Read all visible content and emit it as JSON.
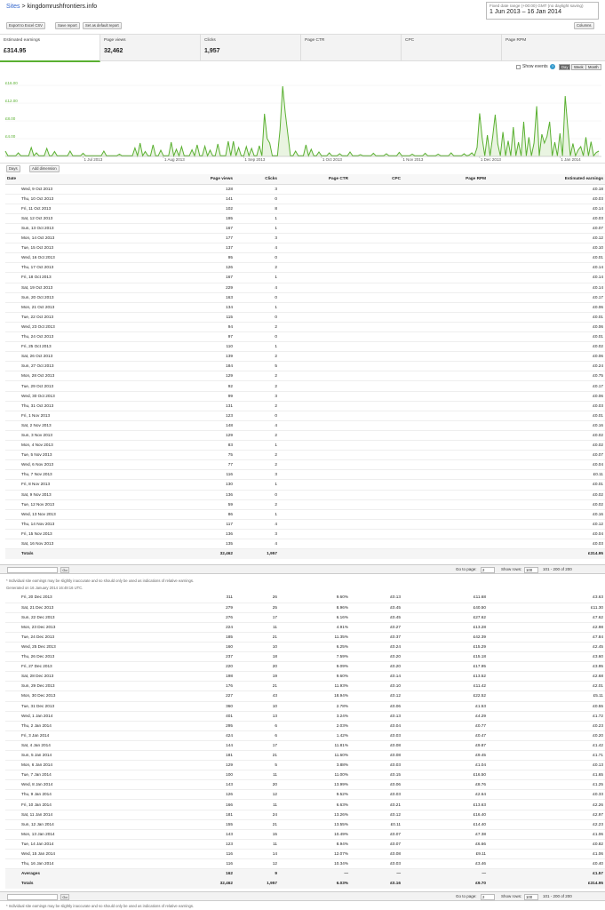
{
  "header": {
    "crumb_root": "Sites",
    "crumb_sep": ">",
    "site": "kingdomrushfrontiers.info",
    "date_hint": "Fixed date range (+00:00) GMT (no daylight saving)",
    "date_range": "1 Jun 2013 – 16 Jan 2014"
  },
  "toolbar": {
    "export": "Export to Excel CSV",
    "save": "Save report",
    "default": "Set as default report",
    "columns": "Columns"
  },
  "tabs": [
    {
      "label": "Estimated earnings",
      "value": "£314.95"
    },
    {
      "label": "Page views",
      "value": "32,462"
    },
    {
      "label": "Clicks",
      "value": "1,957"
    },
    {
      "label": "Page CTR",
      "value": ""
    },
    {
      "label": "CPC",
      "value": ""
    },
    {
      "label": "Page RPM",
      "value": ""
    }
  ],
  "chart_opts": {
    "show_events": "Show events",
    "help": "?",
    "day": "Day",
    "week": "Week",
    "month": "Month"
  },
  "chart_data": {
    "type": "area",
    "series_color": "#5ab031",
    "y_ticks": [
      "£16.00",
      "£12.00",
      "£8.00",
      "£4.00"
    ],
    "ylim": [
      0,
      18
    ],
    "x_ticks": [
      "1 Jul 2013",
      "1 Aug 2013",
      "1 Sep 2013",
      "1 Oct 2013",
      "1 Nov 2013",
      "1 Dec 2013",
      "1 Jan 2014"
    ],
    "x_tick_days": [
      30,
      61,
      92,
      122,
      153,
      183,
      214
    ],
    "n_days": 230,
    "peaks": [
      [
        0,
        1.2
      ],
      [
        5,
        0.8
      ],
      [
        10,
        2.0
      ],
      [
        12,
        0.8
      ],
      [
        16,
        1.8
      ],
      [
        19,
        1.1
      ],
      [
        25,
        1.2
      ],
      [
        30,
        0.7
      ],
      [
        38,
        1.2
      ],
      [
        44,
        0.5
      ],
      [
        50,
        1.9
      ],
      [
        52,
        3.0
      ],
      [
        54,
        1.1
      ],
      [
        57,
        2.6
      ],
      [
        60,
        1.4
      ],
      [
        64,
        3.2
      ],
      [
        66,
        1.6
      ],
      [
        68,
        2.2
      ],
      [
        72,
        1.5
      ],
      [
        74,
        2.6
      ],
      [
        77,
        2.3
      ],
      [
        79,
        1.4
      ],
      [
        82,
        2.8
      ],
      [
        86,
        3.4
      ],
      [
        88,
        3.4
      ],
      [
        90,
        2.0
      ],
      [
        93,
        2.2
      ],
      [
        95,
        1.8
      ],
      [
        98,
        2.4
      ],
      [
        100,
        9.6
      ],
      [
        101,
        4.0
      ],
      [
        102,
        3.0
      ],
      [
        106,
        6.0
      ],
      [
        107,
        15.8
      ],
      [
        108,
        9.8
      ],
      [
        109,
        5.0
      ],
      [
        112,
        1.2
      ],
      [
        116,
        2.6
      ],
      [
        118,
        1.6
      ],
      [
        121,
        1.0
      ],
      [
        125,
        0.8
      ],
      [
        129,
        0.6
      ],
      [
        133,
        1.0
      ],
      [
        137,
        0.4
      ],
      [
        142,
        0.7
      ],
      [
        147,
        0.6
      ],
      [
        152,
        0.9
      ],
      [
        157,
        0.5
      ],
      [
        162,
        0.7
      ],
      [
        167,
        0.5
      ],
      [
        172,
        0.8
      ],
      [
        177,
        0.6
      ],
      [
        179,
        0.3
      ],
      [
        180,
        0.8
      ],
      [
        182,
        2.0
      ],
      [
        183,
        9.7
      ],
      [
        184,
        4.0
      ],
      [
        186,
        4.8
      ],
      [
        188,
        4.3
      ],
      [
        189,
        9.4
      ],
      [
        190,
        2.8
      ],
      [
        192,
        5.5
      ],
      [
        194,
        3.5
      ],
      [
        196,
        6.6
      ],
      [
        198,
        3.2
      ],
      [
        200,
        7.8
      ],
      [
        202,
        4.3
      ],
      [
        204,
        3.0
      ],
      [
        205,
        11.3
      ],
      [
        207,
        5.0
      ],
      [
        208,
        3.0
      ],
      [
        209,
        4.5
      ],
      [
        210,
        7.8
      ],
      [
        212,
        3.2
      ],
      [
        214,
        5.2
      ],
      [
        216,
        13.6
      ],
      [
        217,
        6.5
      ],
      [
        219,
        2.9
      ],
      [
        221,
        1.4
      ],
      [
        222,
        2.2
      ],
      [
        224,
        4.3
      ],
      [
        226,
        3.3
      ],
      [
        228,
        0.9
      ],
      [
        229,
        1.2
      ]
    ]
  },
  "dims": {
    "primary": "Days",
    "add": "Add dimension"
  },
  "table_headers": [
    "Date",
    "Page views",
    "Clicks",
    "Page CTR",
    "CPC",
    "Page RPM",
    "Estimated earnings"
  ],
  "rows1": [
    [
      "Wed, 9 Oct 2013",
      "128",
      "3",
      "",
      "",
      "",
      "£0.18"
    ],
    [
      "Thu, 10 Oct 2013",
      "141",
      "0",
      "",
      "",
      "",
      "£0.03"
    ],
    [
      "Fri, 11 Oct 2013",
      "102",
      "8",
      "",
      "",
      "",
      "£0.14"
    ],
    [
      "Sat, 12 Oct 2013",
      "195",
      "1",
      "",
      "",
      "",
      "£0.03"
    ],
    [
      "Sun, 13 Oct 2013",
      "167",
      "1",
      "",
      "",
      "",
      "£0.07"
    ],
    [
      "Mon, 14 Oct 2013",
      "177",
      "3",
      "",
      "",
      "",
      "£0.12"
    ],
    [
      "Tue, 15 Oct 2013",
      "137",
      "4",
      "",
      "",
      "",
      "£0.10"
    ],
    [
      "Wed, 16 Oct 2013",
      "95",
      "0",
      "",
      "",
      "",
      "£0.01"
    ],
    [
      "Thu, 17 Oct 2013",
      "126",
      "2",
      "",
      "",
      "",
      "£0.14"
    ],
    [
      "Fri, 18 Oct 2013",
      "167",
      "1",
      "",
      "",
      "",
      "£0.14"
    ],
    [
      "Sat, 19 Oct 2013",
      "229",
      "4",
      "",
      "",
      "",
      "£0.14"
    ],
    [
      "Sun, 20 Oct 2013",
      "163",
      "0",
      "",
      "",
      "",
      "£0.17"
    ],
    [
      "Mon, 21 Oct 2013",
      "134",
      "1",
      "",
      "",
      "",
      "£0.06"
    ],
    [
      "Tue, 22 Oct 2013",
      "115",
      "0",
      "",
      "",
      "",
      "£0.01"
    ],
    [
      "Wed, 23 Oct 2013",
      "94",
      "2",
      "",
      "",
      "",
      "£0.06"
    ],
    [
      "Thu, 24 Oct 2013",
      "97",
      "0",
      "",
      "",
      "",
      "£0.01"
    ],
    [
      "Fri, 25 Oct 2013",
      "110",
      "1",
      "",
      "",
      "",
      "£0.02"
    ],
    [
      "Sat, 26 Oct 2013",
      "139",
      "2",
      "",
      "",
      "",
      "£0.06"
    ],
    [
      "Sun, 27 Oct 2013",
      "184",
      "5",
      "",
      "",
      "",
      "£0.24"
    ],
    [
      "Mon, 28 Oct 2013",
      "129",
      "2",
      "",
      "",
      "",
      "£0.75"
    ],
    [
      "Tue, 29 Oct 2013",
      "92",
      "2",
      "",
      "",
      "",
      "£0.17"
    ],
    [
      "Wed, 30 Oct 2013",
      "99",
      "3",
      "",
      "",
      "",
      "£0.06"
    ],
    [
      "Thu, 31 Oct 2013",
      "131",
      "2",
      "",
      "",
      "",
      "£0.03"
    ],
    [
      "Fri, 1 Nov 2013",
      "123",
      "0",
      "",
      "",
      "",
      "£0.01"
    ],
    [
      "Sat, 2 Nov 2013",
      "148",
      "4",
      "",
      "",
      "",
      "£0.16"
    ],
    [
      "Sun, 3 Nov 2013",
      "129",
      "2",
      "",
      "",
      "",
      "£0.02"
    ],
    [
      "Mon, 4 Nov 2013",
      "83",
      "1",
      "",
      "",
      "",
      "£0.02"
    ],
    [
      "Tue, 5 Nov 2013",
      "75",
      "2",
      "",
      "",
      "",
      "£0.07"
    ],
    [
      "Wed, 6 Nov 2013",
      "77",
      "2",
      "",
      "",
      "",
      "£0.04"
    ],
    [
      "Thu, 7 Nov 2013",
      "116",
      "3",
      "",
      "",
      "",
      "£0.11"
    ],
    [
      "Fri, 8 Nov 2013",
      "130",
      "1",
      "",
      "",
      "",
      "£0.01"
    ],
    [
      "Sat, 9 Nov 2013",
      "136",
      "0",
      "",
      "",
      "",
      "£0.02"
    ],
    [
      "Tue, 12 Nov 2013",
      "59",
      "2",
      "",
      "",
      "",
      "£0.02"
    ],
    [
      "Wed, 13 Nov 2013",
      "86",
      "1",
      "",
      "",
      "",
      "£0.16"
    ],
    [
      "Thu, 14 Nov 2013",
      "117",
      "4",
      "",
      "",
      "",
      "£0.12"
    ],
    [
      "Fri, 15 Nov 2013",
      "136",
      "3",
      "",
      "",
      "",
      "£0.04"
    ],
    [
      "Sat, 16 Nov 2013",
      "135",
      "4",
      "",
      "",
      "",
      "£0.03"
    ]
  ],
  "totals1": [
    "Totals",
    "32,462",
    "1,957",
    "",
    "",
    "",
    "£314.95"
  ],
  "pager": {
    "goto": "Go to page:",
    "page": "2",
    "show_rows": "Show rows:",
    "rows": "100",
    "range": "101 - 200 of 200",
    "go": "Go"
  },
  "note1": "* Individual site earnings may be slightly inaccurate and so should only be used as indications of relative earnings.",
  "generated": "Generated on 16 January 2014 16:49:16 UTC.",
  "rows2": [
    [
      "Fri, 20 Dec 2013",
      "311",
      "26",
      "9.60%",
      "£0.13",
      "£11.68",
      "£3.63"
    ],
    [
      "Sat, 21 Dec 2013",
      "279",
      "25",
      "8.96%",
      "£0.45",
      "£40.50",
      "£11.30"
    ],
    [
      "Sun, 22 Dec 2013",
      "276",
      "17",
      "6.16%",
      "£0.45",
      "£27.62",
      "£7.62"
    ],
    [
      "Mon, 23 Dec 2013",
      "224",
      "11",
      "4.91%",
      "£0.27",
      "£13.28",
      "£2.98"
    ],
    [
      "Tue, 24 Dec 2013",
      "185",
      "21",
      "11.35%",
      "£0.37",
      "£42.39",
      "£7.84"
    ],
    [
      "Wed, 25 Dec 2013",
      "160",
      "10",
      "6.25%",
      "£0.24",
      "£15.29",
      "£2.45"
    ],
    [
      "Thu, 26 Dec 2013",
      "237",
      "18",
      "7.59%",
      "£0.20",
      "£15.18",
      "£3.60"
    ],
    [
      "Fri, 27 Dec 2013",
      "220",
      "20",
      "9.09%",
      "£0.20",
      "£17.95",
      "£3.95"
    ],
    [
      "Sat, 28 Dec 2013",
      "198",
      "19",
      "9.60%",
      "£0.14",
      "£13.52",
      "£2.68"
    ],
    [
      "Sun, 29 Dec 2013",
      "176",
      "21",
      "11.93%",
      "£0.10",
      "£11.42",
      "£2.01"
    ],
    [
      "Mon, 30 Dec 2013",
      "227",
      "43",
      "18.94%",
      "£0.12",
      "£22.52",
      "£5.11"
    ],
    [
      "Tue, 31 Dec 2013",
      "360",
      "10",
      "2.78%",
      "£0.06",
      "£1.53",
      "£0.55"
    ],
    [
      "Wed, 1 Jan 2014",
      "401",
      "13",
      "3.24%",
      "£0.13",
      "£4.29",
      "£1.72"
    ],
    [
      "Thu, 2 Jan 2014",
      "295",
      "6",
      "2.03%",
      "£0.04",
      "£0.77",
      "£0.23"
    ],
    [
      "Fri, 3 Jan 2014",
      "424",
      "6",
      "1.42%",
      "£0.03",
      "£0.47",
      "£0.20"
    ],
    [
      "Sat, 4 Jan 2014",
      "144",
      "17",
      "11.81%",
      "£0.08",
      "£9.87",
      "£1.42"
    ],
    [
      "Sun, 5 Jan 2014",
      "181",
      "21",
      "11.60%",
      "£0.08",
      "£9.45",
      "£1.71"
    ],
    [
      "Mon, 6 Jan 2014",
      "129",
      "5",
      "3.88%",
      "£0.03",
      "£1.04",
      "£0.13"
    ],
    [
      "Tue, 7 Jan 2014",
      "100",
      "11",
      "11.00%",
      "£0.15",
      "£16.50",
      "£1.65"
    ],
    [
      "Wed, 8 Jan 2014",
      "143",
      "20",
      "13.99%",
      "£0.06",
      "£8.76",
      "£1.25"
    ],
    [
      "Thu, 9 Jan 2014",
      "126",
      "12",
      "9.52%",
      "£0.03",
      "£2.64",
      "£0.33"
    ],
    [
      "Fri, 10 Jan 2014",
      "166",
      "11",
      "6.63%",
      "£0.21",
      "£13.63",
      "£2.26"
    ],
    [
      "Sat, 11 Jan 2014",
      "181",
      "24",
      "13.26%",
      "£0.12",
      "£16.40",
      "£2.97"
    ],
    [
      "Sun, 12 Jan 2014",
      "155",
      "21",
      "13.55%",
      "£0.11",
      "£14.40",
      "£2.23"
    ],
    [
      "Mon, 13 Jan 2014",
      "143",
      "15",
      "10.49%",
      "£0.07",
      "£7.38",
      "£1.06"
    ],
    [
      "Tue, 14 Jan 2014",
      "123",
      "11",
      "8.94%",
      "£0.07",
      "£6.66",
      "£0.82"
    ],
    [
      "Wed, 15 Jan 2014",
      "116",
      "14",
      "12.07%",
      "£0.08",
      "£9.11",
      "£1.06"
    ],
    [
      "Thu, 16 Jan 2014",
      "116",
      "12",
      "10.34%",
      "£0.03",
      "£3.46",
      "£0.40"
    ]
  ],
  "averages": [
    "Averages",
    "162",
    "9",
    "—",
    "—",
    "—",
    "£1.57"
  ],
  "totals2": [
    "Totals",
    "32,462",
    "1,957",
    "6.03%",
    "£0.16",
    "£9.70",
    "£314.95"
  ],
  "note2": "* Individual site earnings may be slightly inaccurate and so should only be used as indications of relative earnings."
}
